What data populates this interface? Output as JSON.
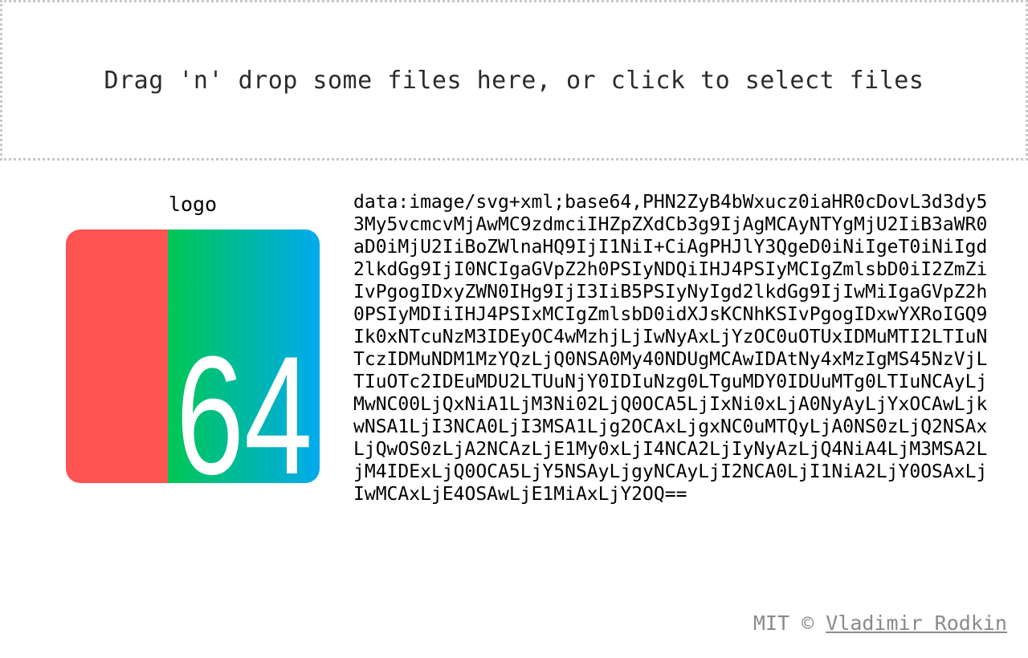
{
  "dropzone": {
    "text": "Drag 'n' drop some files here, or click to select files"
  },
  "file": {
    "name": "logo",
    "thumbnail": {
      "icon": "base64-logo-icon",
      "label": "64",
      "colors": {
        "red": "#ff5252",
        "green": "#00c853",
        "blue": "#00aaee",
        "digits": "#ffffff"
      }
    },
    "data_uri": "data:image/svg+xml;base64,PHN2ZyB4bWxucz0iaHR0cDovL3d3dy53My5vcmcvMjAwMC9zdmciIHZpZXdCb3g9IjAgMCAyNTYgMjU2IiB3aWR0aD0iMjU2IiBoZWlnaHQ9IjI1NiI+CiAgPHJlY3QgeD0iNiIgeT0iNiIgd2lkdGg9IjI0NCIgaGVpZ2h0PSIyNDQiIHJ4PSIyMCIgZmlsbD0iI2ZmZiIvPgogIDxyZWN0IHg9IjI3IiB5PSIyNyIgd2lkdGg9IjIwMiIgaGVpZ2h0PSIyMDIiIHJ4PSIxMCIgZmlsbD0idXJsKCNhKSIvPgogIDxwYXRoIGQ9Ik0xNTcuNzM3IDEyOC4wMzhjLjIwNyAxLjYzOC0uOTUxIDMuMTI2LTIuNTczIDMuNDM1MzYQzLjQ0NSA0My40NDUgMCAwIDAtNy4xMzIgMS45NzVjLTIuOTc2IDEuMDU2LTUuNjY0IDIuNzg0LTguMDY0IDUuMTg0LTIuNCAyLjMwNC00LjQxNiA1LjM3Ni02LjQ0OCA5LjIxNi0xLjA0NyAyLjYxOCAwLjkwNSA1LjI3NCA0LjI3MSA1Ljg2OCAxLjgxNC0uMTQyLjA0NS0zLjQ2NSAxLjQwOS0zLjA2NCAzLjE1My0xLjI4NCA2LjIyNyAzLjQ4NiA4LjM3MSA2LjM4IDExLjQ0OCA5LjY5NSAyLjgyNCAyLjI2NCA0LjI1NiA2LjY0OSAxLjIwMCAxLjE4OSAwLjE1MiAxLjY2OQ=="
  },
  "footer": {
    "license": "MIT ©",
    "author": "Vladimir Rodkin"
  }
}
